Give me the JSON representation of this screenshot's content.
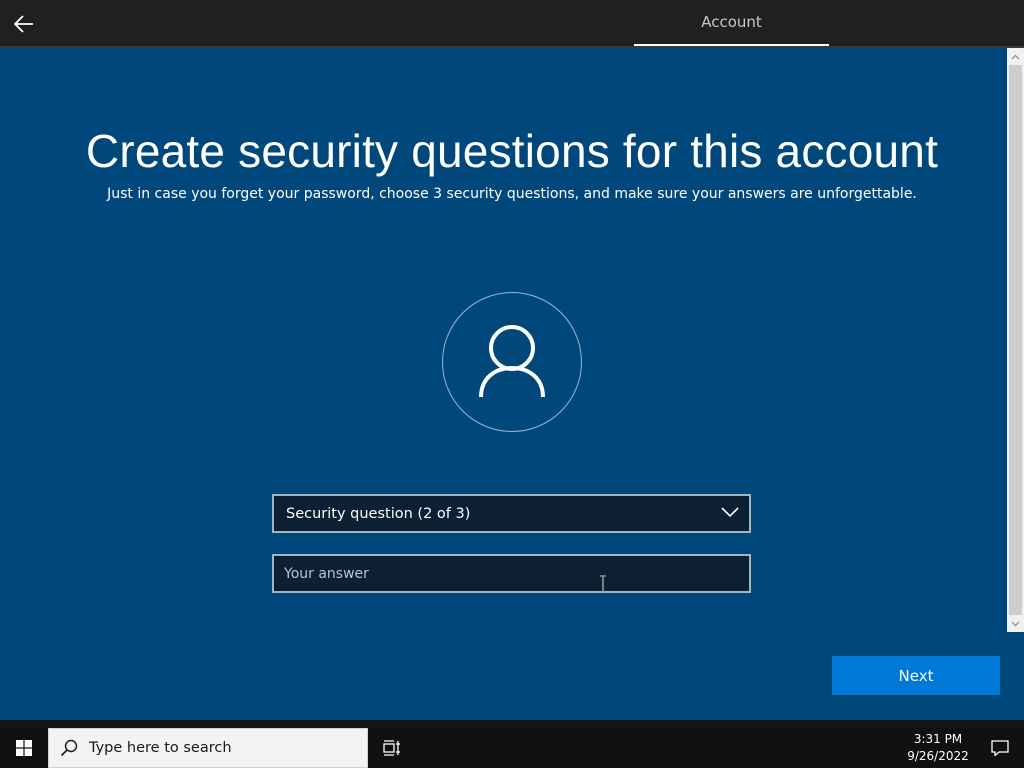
{
  "header": {
    "back_icon": "arrow-left-icon",
    "tab_label": "Account"
  },
  "main": {
    "title": "Create security questions for this account",
    "subtitle": "Just in case you forget your password, choose 3 security questions, and make sure your answers are unforgettable.",
    "avatar_icon": "user-icon",
    "security_question": {
      "selected": "Security question (2 of 3)",
      "chevron_icon": "chevron-down-icon"
    },
    "answer": {
      "value": "",
      "placeholder": "Your answer"
    },
    "next_label": "Next"
  },
  "taskbar": {
    "start_icon": "windows-icon",
    "search_placeholder": "Type here to search",
    "search_icon": "search-icon",
    "task_view_icon": "task-view-icon",
    "time": "3:31 PM",
    "date": "9/26/2022",
    "notification_icon": "notification-icon"
  },
  "colors": {
    "background": "#00477c",
    "topbar": "#202020",
    "accent": "#0078d7",
    "input_bg": "#0c1f33",
    "taskbar": "#101010"
  }
}
